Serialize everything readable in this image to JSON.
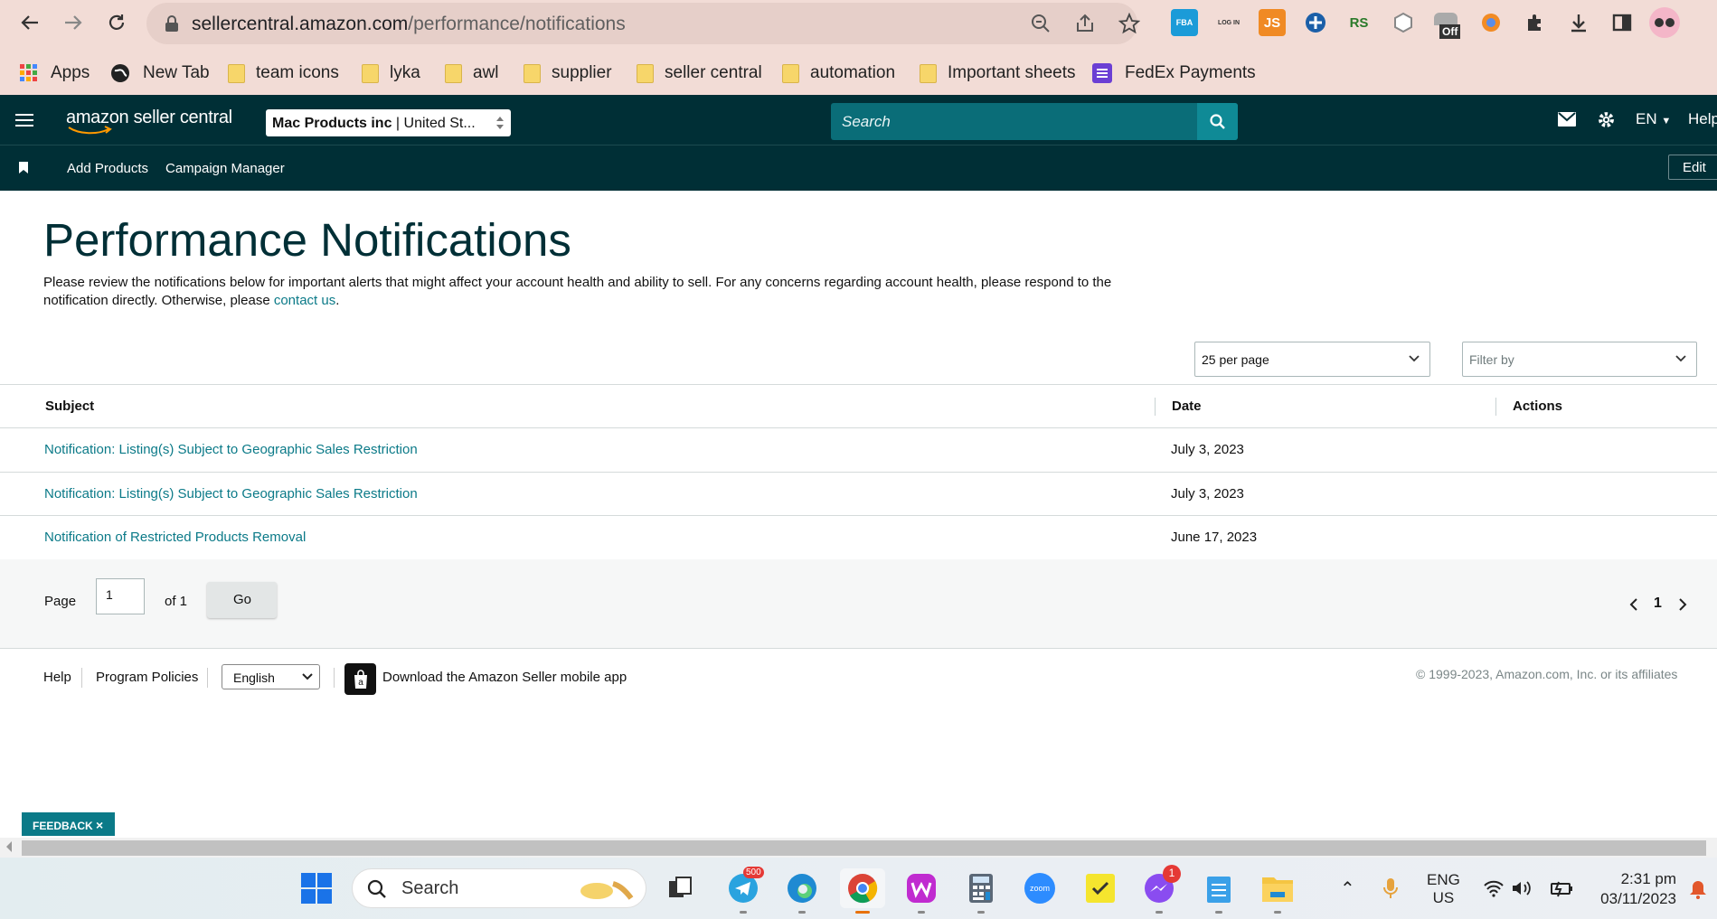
{
  "browser": {
    "url_host": "sellercentral.amazon.com",
    "url_path": "/performance/notifications",
    "bookmarks": [
      "Apps",
      "New Tab",
      "team icons",
      "lyka",
      "awl",
      "supplier",
      "seller central",
      "automation",
      "Important sheets",
      "FedEx Payments"
    ],
    "ext_labels": {
      "fba": "FBA",
      "login": "LOG IN",
      "js": "JS",
      "rs": "RS",
      "off": "Off"
    }
  },
  "header": {
    "logo": "amazon seller central",
    "store_name": "Mac Products inc",
    "store_region": " | United St...",
    "search_placeholder": "Search",
    "language": "EN",
    "help": "Help"
  },
  "subnav": {
    "items": [
      "Add Products",
      "Campaign Manager"
    ],
    "edit": "Edit"
  },
  "page": {
    "title": "Performance Notifications",
    "intro": "Please review the notifications below for important alerts that might affect your account health and ability to sell. For any concerns regarding account health, please respond to the notification directly. Otherwise, please ",
    "contact_link": "contact us",
    "intro_end": "."
  },
  "controls": {
    "per_page": "25 per page",
    "filter_placeholder": "Filter by"
  },
  "table": {
    "headers": {
      "subject": "Subject",
      "date": "Date",
      "actions": "Actions"
    },
    "rows": [
      {
        "subject": "Notification: Listing(s) Subject to Geographic Sales Restriction",
        "date": "July 3, 2023"
      },
      {
        "subject": "Notification: Listing(s) Subject to Geographic Sales Restriction",
        "date": "July 3, 2023"
      },
      {
        "subject": "Notification of Restricted Products Removal",
        "date": "June 17, 2023"
      }
    ]
  },
  "pager": {
    "page_label": "Page",
    "page_value": "1",
    "of_label": "of 1",
    "go": "Go",
    "current": "1"
  },
  "footer": {
    "help": "Help",
    "policies": "Program Policies",
    "language": "English",
    "app_text": "Download the Amazon Seller mobile app",
    "copyright": "© 1999-2023, Amazon.com, Inc. or its affiliates"
  },
  "feedback": "FEEDBACK",
  "taskbar": {
    "search": "Search",
    "telegram_badge": "500",
    "messenger_badge": "1",
    "lang_line1": "ENG",
    "lang_line2": "US",
    "time": "2:31 pm",
    "date": "03/11/2023"
  },
  "colors": {
    "header_bg": "#002f36",
    "link": "#0b7a88",
    "chrome_bg": "#f2dcd6"
  }
}
